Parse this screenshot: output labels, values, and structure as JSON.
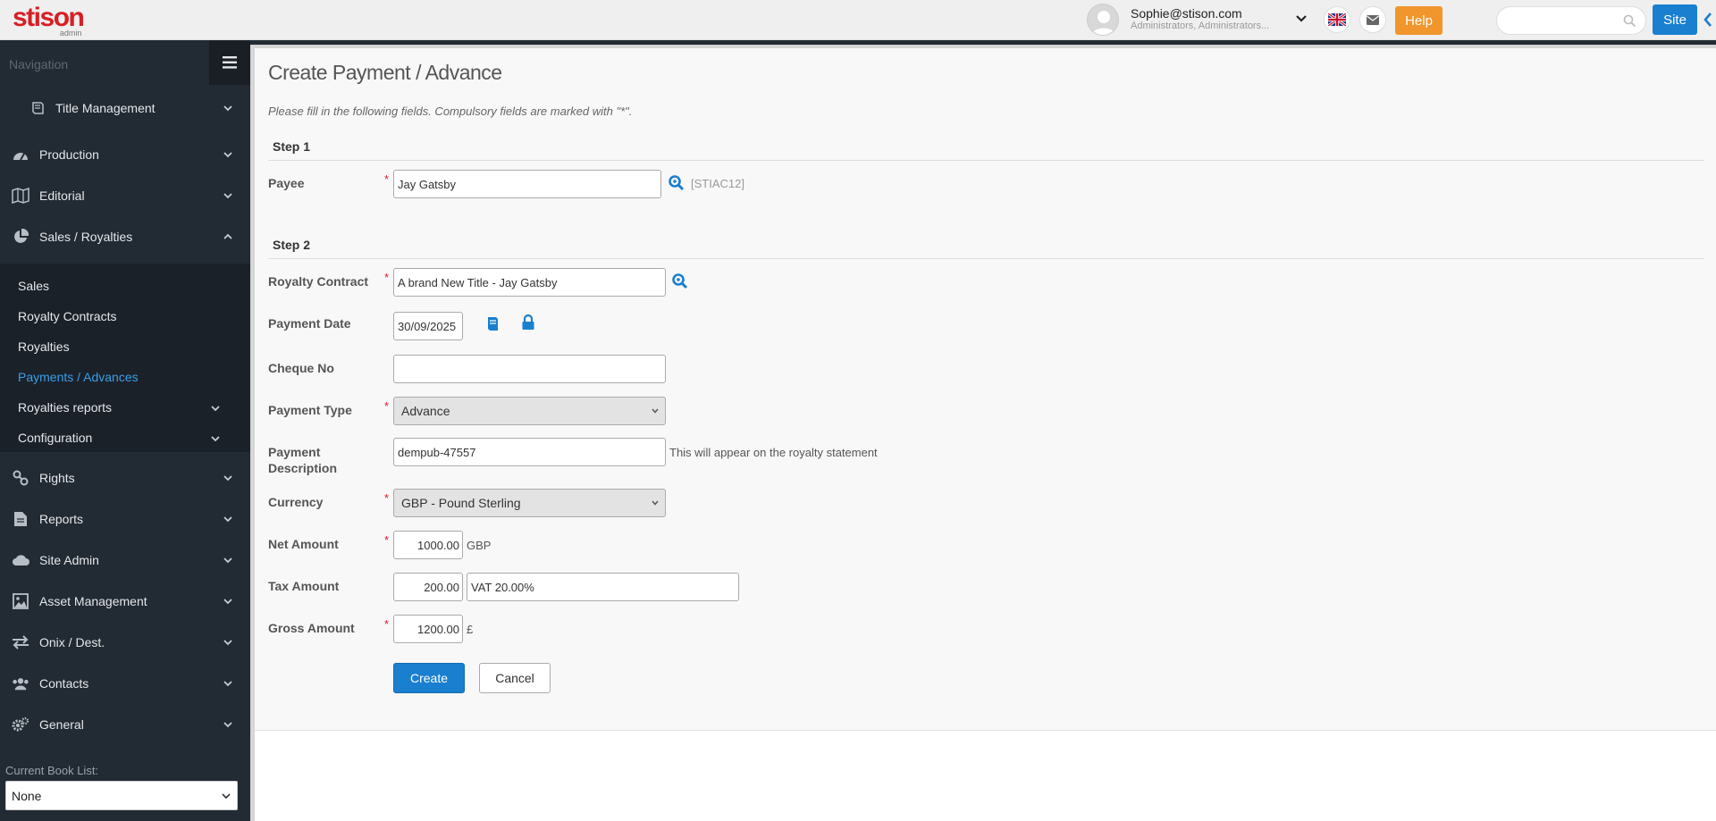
{
  "brand": {
    "logo_text": "stison",
    "logo_sub": "admin"
  },
  "header": {
    "user_email": "Sophie@stison.com",
    "user_roles": "Administrators, Administrators...",
    "help_label": "Help",
    "search_placeholder": "",
    "site_label": "Site"
  },
  "sidebar": {
    "nav_label": "Navigation",
    "items": [
      {
        "label": "Title Management",
        "icon": "book-icon"
      },
      {
        "label": "Production",
        "icon": "dashboard-icon"
      },
      {
        "label": "Editorial",
        "icon": "map-icon"
      },
      {
        "label": "Sales / Royalties",
        "icon": "pie-chart-icon"
      },
      {
        "label": "Rights",
        "icon": "link-icon"
      },
      {
        "label": "Reports",
        "icon": "file-icon"
      },
      {
        "label": "Site Admin",
        "icon": "cloud-icon"
      },
      {
        "label": "Asset Management",
        "icon": "image-icon"
      },
      {
        "label": "Onix / Dest.",
        "icon": "exchange-icon"
      },
      {
        "label": "Contacts",
        "icon": "users-icon"
      },
      {
        "label": "General",
        "icon": "cogs-icon"
      }
    ],
    "sub_items": [
      {
        "label": "Sales"
      },
      {
        "label": "Royalty Contracts"
      },
      {
        "label": "Royalties"
      },
      {
        "label": "Payments / Advances"
      },
      {
        "label": "Royalties reports"
      },
      {
        "label": "Configuration"
      }
    ],
    "booklist_label": "Current Book List:",
    "booklist_value": "None"
  },
  "form": {
    "title": "Create Payment / Advance",
    "instructions": "Please fill in the following fields. Compulsory fields are marked with \"*\".",
    "required_mark": "*",
    "step1": "Step 1",
    "step2": "Step 2",
    "payee_label": "Payee",
    "payee_value": "Jay Gatsby",
    "payee_code": "[STIAC12]",
    "contract_label": "Royalty Contract",
    "contract_value": "A brand New Title - Jay Gatsby",
    "date_label": "Payment Date",
    "date_value": "30/09/2025",
    "cheque_label": "Cheque No",
    "cheque_value": "",
    "type_label": "Payment Type",
    "type_value": "Advance",
    "desc_label_1": "Payment",
    "desc_label_2": "Description",
    "desc_value": "dempub-47557",
    "desc_hint": "This will appear on the royalty statement",
    "currency_label": "Currency",
    "currency_value": "GBP - Pound Sterling",
    "net_label": "Net Amount",
    "net_value": "1000.00",
    "net_unit": "GBP",
    "tax_label": "Tax Amount",
    "tax_value": "200.00",
    "tax_desc": "VAT 20.00%",
    "gross_label": "Gross Amount",
    "gross_value": "1200.00",
    "gross_unit": "£",
    "create_label": "Create",
    "cancel_label": "Cancel"
  },
  "colors": {
    "accent": "#1a7fcf",
    "help": "#f0962c",
    "brand": "#d81e24",
    "sidebar_bg": "#222a33",
    "active_link": "#3a9ee6"
  }
}
